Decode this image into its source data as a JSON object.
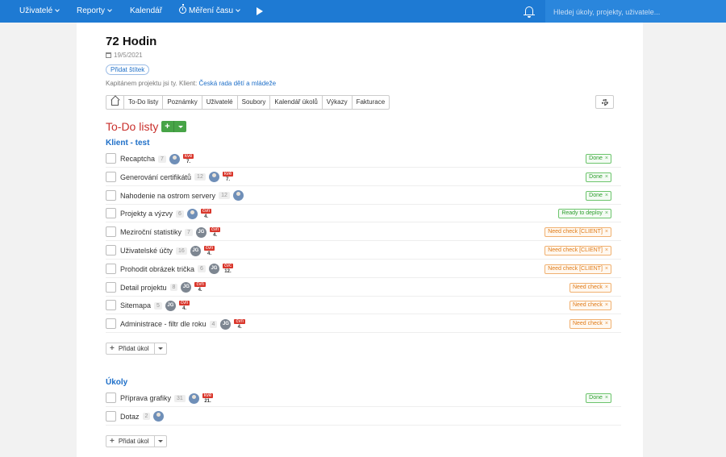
{
  "nav": {
    "users": "Uživatelé",
    "reports": "Reporty",
    "calendar": "Kalendář",
    "time": "Měření času",
    "search_placeholder": "Hledej úkoly, projekty, uživatele..."
  },
  "project": {
    "title": "72 Hodin",
    "date": "19/5/2021",
    "add_tag": "Přidat štítek",
    "captain_text": "Kapitánem projektu jsi ty. Klient: ",
    "client": "Česká rada dětí a mládeže"
  },
  "tabs": [
    "To-Do listy",
    "Poznámky",
    "Uživatelé",
    "Soubory",
    "Kalendář úkolů",
    "Výkazy",
    "Fakturace"
  ],
  "section_title": "To-Do listy",
  "add_task_label": "Přidat úkol",
  "lists": [
    {
      "title": "Klient - test",
      "tasks": [
        {
          "name": "Recaptcha",
          "count": "7",
          "avatar": "photo",
          "due_day": "kvě",
          "due_num": "7.",
          "status": "Done",
          "status_color": "green"
        },
        {
          "name": "Generování certifikátů",
          "count": "12",
          "avatar": "photo",
          "due_day": "kvě",
          "due_num": "7.",
          "status": "Done",
          "status_color": "green"
        },
        {
          "name": "Nahodenie na ostrom servery",
          "count": "12",
          "avatar": "photo",
          "due_day": "",
          "due_num": "",
          "status": "Done",
          "status_color": "green"
        },
        {
          "name": "Projekty a výzvy",
          "count": "6",
          "avatar": "photo",
          "due_day": "čvn",
          "due_num": "4.",
          "status": "Ready to deploy",
          "status_color": "green"
        },
        {
          "name": "Meziroční statistiky",
          "count": "7",
          "avatar": "JG",
          "due_day": "čvn",
          "due_num": "4.",
          "status": "Need check [CLIENT]",
          "status_color": "orange"
        },
        {
          "name": "Uživatelské účty",
          "count": "16",
          "avatar": "JG",
          "due_day": "čvn",
          "due_num": "4.",
          "status": "Need check [CLIENT]",
          "status_color": "orange"
        },
        {
          "name": "Prohodit obrázek trička",
          "count": "6",
          "avatar": "JG",
          "due_day": "čvc",
          "due_num": "12.",
          "status": "Need check [CLIENT]",
          "status_color": "orange"
        },
        {
          "name": "Detail projektu",
          "count": "8",
          "avatar": "JG",
          "due_day": "čvn",
          "due_num": "4.",
          "status": "Need check",
          "status_color": "orange"
        },
        {
          "name": "Sitemapa",
          "count": "5",
          "avatar": "JG",
          "due_day": "čvn",
          "due_num": "4.",
          "status": "Need check",
          "status_color": "orange"
        },
        {
          "name": "Administrace - filtr dle roku",
          "count": "4",
          "avatar": "JG",
          "due_day": "čvn",
          "due_num": "4.",
          "status": "Need check",
          "status_color": "orange"
        }
      ]
    },
    {
      "title": "Úkoly",
      "tasks": [
        {
          "name": "Příprava grafiky",
          "count": "31",
          "avatar": "photo",
          "due_day": "kvě",
          "due_num": "21.",
          "status": "Done",
          "status_color": "green"
        },
        {
          "name": "Dotaz",
          "count": "2",
          "avatar": "photo",
          "due_day": "",
          "due_num": "",
          "status": "",
          "status_color": ""
        }
      ]
    }
  ]
}
